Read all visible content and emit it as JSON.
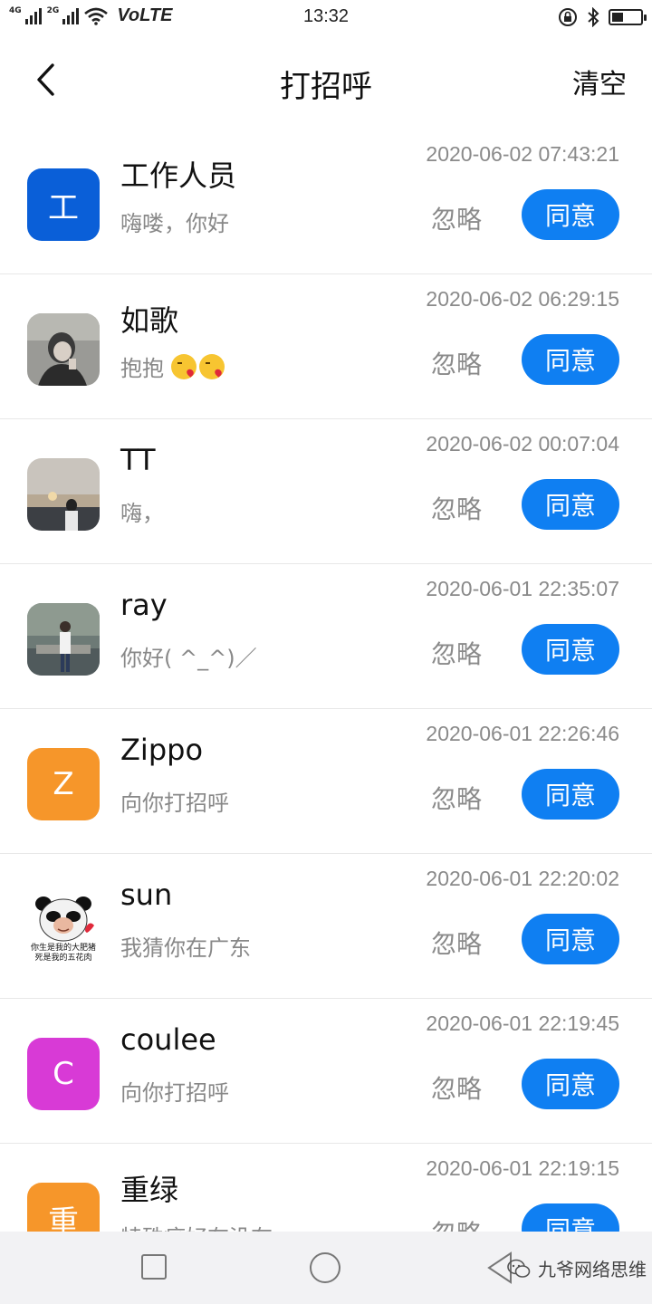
{
  "status_bar": {
    "sig1_tag": "4G",
    "sig2_tag": "2G",
    "volte": "VoLTE",
    "time": "13:32"
  },
  "header": {
    "title": "打招呼",
    "clear_label": "清空"
  },
  "requests": [
    {
      "avatar_letter": "工",
      "avatar_color": "#0a5fd8",
      "name": "工作人员",
      "message": "嗨喽，你好",
      "time": "2020-06-02 07:43:21",
      "ignore_label": "忽略",
      "agree_label": "同意"
    },
    {
      "avatar_letter": "",
      "avatar_color": "#6b6b6b",
      "name": "如歌",
      "message": "抱抱",
      "emojis": [
        "kiss-emoji",
        "kiss-emoji"
      ],
      "time": "2020-06-02 06:29:15",
      "ignore_label": "忽略",
      "agree_label": "同意"
    },
    {
      "avatar_letter": "",
      "avatar_color": "#8a8f96",
      "name": "TT",
      "message": "嗨，",
      "time": "2020-06-02 00:07:04",
      "ignore_label": "忽略",
      "agree_label": "同意"
    },
    {
      "avatar_letter": "",
      "avatar_color": "#5c6a6e",
      "name": "ray",
      "message": "你好( ^_^)／",
      "time": "2020-06-01 22:35:07",
      "ignore_label": "忽略",
      "agree_label": "同意"
    },
    {
      "avatar_letter": "Z",
      "avatar_color": "#f6962a",
      "name": "Zippo",
      "message": "向你打招呼",
      "time": "2020-06-01 22:26:46",
      "ignore_label": "忽略",
      "agree_label": "同意"
    },
    {
      "avatar_letter": "",
      "avatar_color": "#ffffff",
      "name": "sun",
      "message": "我猜你在广东",
      "avatar_caption_1": "你生是我的大肥猪",
      "avatar_caption_2": "死是我的五花肉",
      "time": "2020-06-01 22:20:02",
      "ignore_label": "忽略",
      "agree_label": "同意"
    },
    {
      "avatar_letter": "C",
      "avatar_color": "#d83ad6",
      "name": "coulee",
      "message": "向你打招呼",
      "time": "2020-06-01 22:19:45",
      "ignore_label": "忽略",
      "agree_label": "同意"
    },
    {
      "avatar_letter": "重",
      "avatar_color": "#f6962a",
      "name": "重绿",
      "message": "特殊癖好有没有",
      "time": "2020-06-01 22:19:15",
      "ignore_label": "忽略",
      "agree_label": "同意"
    }
  ],
  "watermark": {
    "text": "九爷网络思维"
  }
}
